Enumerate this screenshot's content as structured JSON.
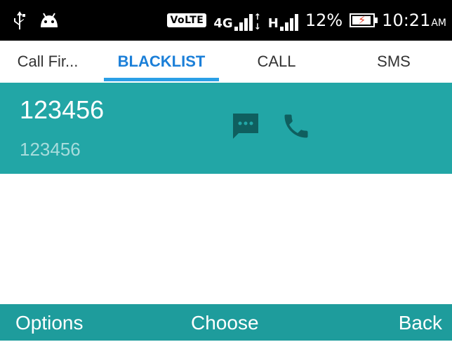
{
  "status_bar": {
    "volte_label": "VoLTE",
    "network_4g": "4G",
    "network_h": "H",
    "battery_percent": "12%",
    "time": "10:21",
    "time_suffix": "AM"
  },
  "tabs": [
    {
      "label": "Call Fir...",
      "active": false
    },
    {
      "label": "BLACKLIST",
      "active": true
    },
    {
      "label": "CALL",
      "active": false
    },
    {
      "label": "SMS",
      "active": false
    }
  ],
  "list": {
    "items": [
      {
        "name": "123456",
        "number": "123456",
        "selected": true
      }
    ]
  },
  "softkeys": {
    "left": "Options",
    "center": "Choose",
    "right": "Back"
  },
  "colors": {
    "accent": "#2a9fe6",
    "selected_row": "#22a6a6",
    "softkey_bar": "#1e9c9c",
    "row_icon": "#0f5f5f"
  }
}
